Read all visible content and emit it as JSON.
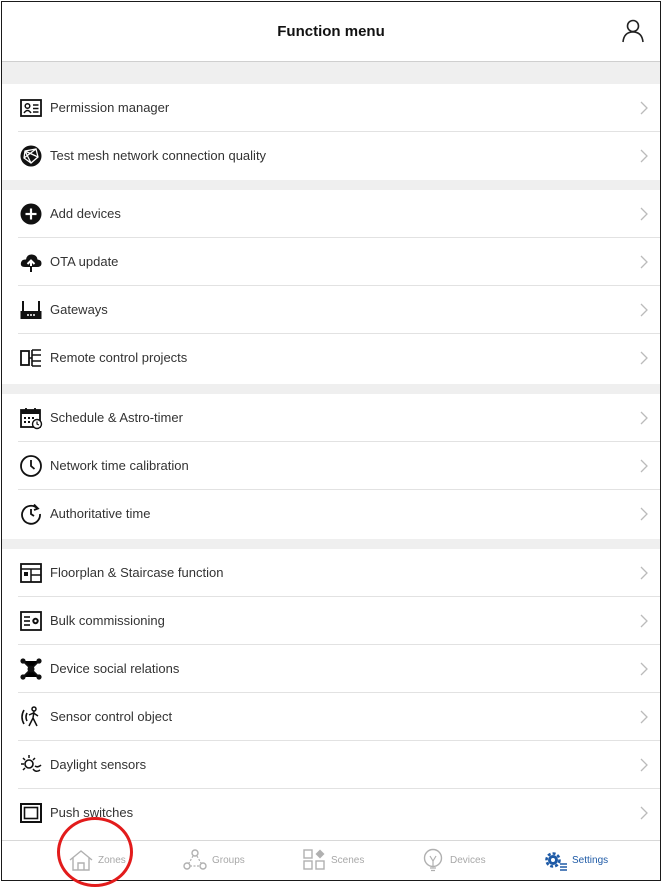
{
  "header": {
    "title": "Function menu",
    "profile_icon": "user-icon"
  },
  "groups": [
    {
      "items": [
        {
          "label": "Permission manager",
          "icon": "id-card-icon"
        },
        {
          "label": "Test mesh network connection quality",
          "icon": "mesh-globe-icon"
        }
      ]
    },
    {
      "items": [
        {
          "label": "Add devices",
          "icon": "add-circle-icon"
        },
        {
          "label": "OTA update",
          "icon": "cloud-upload-icon"
        },
        {
          "label": "Gateways",
          "icon": "gateway-icon"
        },
        {
          "label": "Remote control projects",
          "icon": "remote-project-icon"
        }
      ]
    },
    {
      "items": [
        {
          "label": "Schedule & Astro-timer",
          "icon": "calendar-clock-icon"
        },
        {
          "label": "Network time calibration",
          "icon": "clock-icon"
        },
        {
          "label": "Authoritative time",
          "icon": "time-sync-icon"
        }
      ]
    },
    {
      "items": [
        {
          "label": "Floorplan & Staircase function",
          "icon": "floorplan-icon"
        },
        {
          "label": "Bulk commissioning",
          "icon": "bulk-settings-icon"
        },
        {
          "label": "Device social relations",
          "icon": "network-nodes-icon"
        },
        {
          "label": "Sensor control object",
          "icon": "motion-sensor-icon"
        },
        {
          "label": "Daylight sensors",
          "icon": "sun-icon"
        },
        {
          "label": "Push switches",
          "icon": "push-switch-icon"
        }
      ]
    }
  ],
  "tabbar": {
    "tabs": [
      {
        "label": "Zones",
        "icon": "home-icon",
        "active": false
      },
      {
        "label": "Groups",
        "icon": "groups-icon",
        "active": false
      },
      {
        "label": "Scenes",
        "icon": "scenes-icon",
        "active": false
      },
      {
        "label": "Devices",
        "icon": "bulb-icon",
        "active": false
      },
      {
        "label": "Settings",
        "icon": "settings-gear-icon",
        "active": true
      }
    ]
  },
  "colors": {
    "active_tab": "#1e5aa6",
    "inactive_tab": "#a8a8a8",
    "highlight_circle": "#e21b1b",
    "section_gap": "#efefef"
  }
}
